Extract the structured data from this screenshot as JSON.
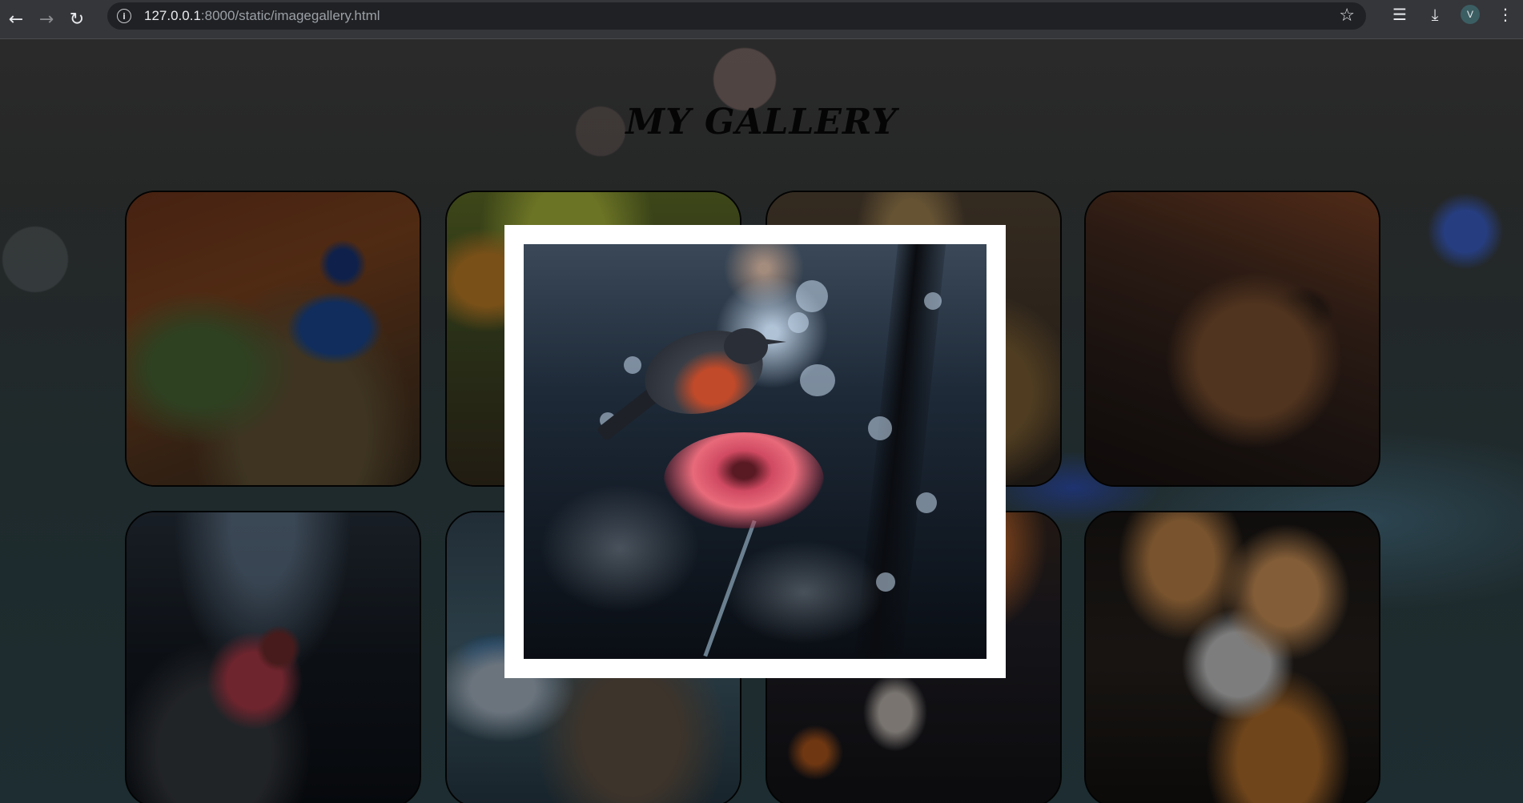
{
  "browser": {
    "url_host": "127.0.0.1",
    "url_rest": ":8000/static/imagegallery.html",
    "profile_initial": "V"
  },
  "page": {
    "title": "MY GALLERY"
  },
  "gallery": {
    "tiles": [
      {
        "subject": "peacock"
      },
      {
        "subject": "hummingbird"
      },
      {
        "subject": "eagle"
      },
      {
        "subject": "robin"
      },
      {
        "subject": "bird-on-red-flower"
      },
      {
        "subject": "wings-over-water"
      },
      {
        "subject": "doves-at-sunset"
      },
      {
        "subject": "bird-splashing-water"
      }
    ],
    "lightbox": {
      "subject": "bird-on-red-flower",
      "open": true
    }
  }
}
